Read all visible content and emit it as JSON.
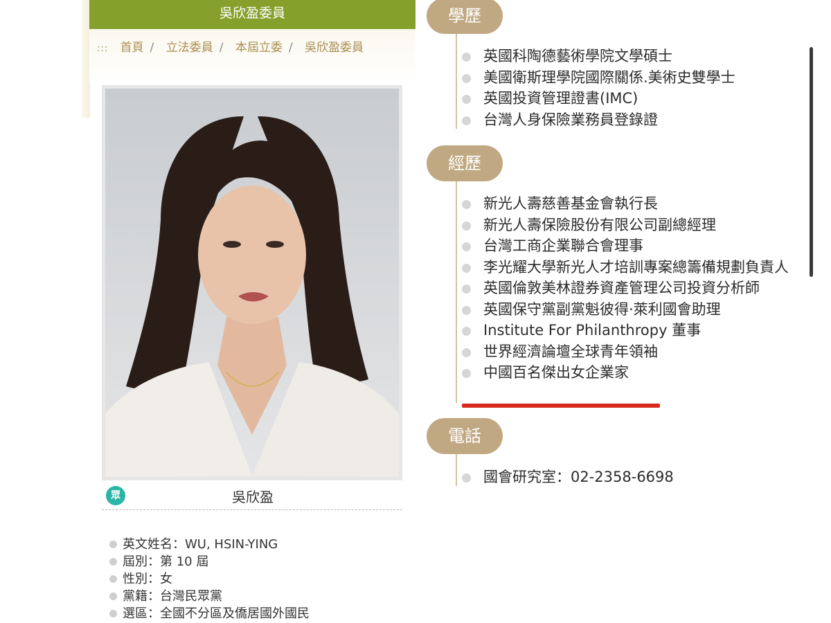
{
  "header": {
    "title": "吳欣盈委員"
  },
  "breadcrumb": {
    "prefix": ":::",
    "items": [
      "首頁",
      "立法委員",
      "本屆立委",
      "吳欣盈委員"
    ]
  },
  "profile": {
    "party_icon_label": "眾",
    "name": "吳欣盈",
    "info": [
      "英文姓名：WU, HSIN-YING",
      "屆別：第 10 屆",
      "性別：女",
      "黨籍：台灣民眾黨",
      "選區：全國不分區及僑居國外國民"
    ]
  },
  "sections": {
    "education": {
      "label": "學歷",
      "items": [
        "英國科陶德藝術學院文學碩士",
        "美國衛斯理學院國際關係.美術史雙學士",
        "英國投資管理證書(IMC)",
        "台灣人身保險業務員登錄證"
      ]
    },
    "experience": {
      "label": "經歷",
      "items": [
        "新光人壽慈善基金會執行長",
        "新光人壽保險股份有限公司副總經理",
        "台灣工商企業聯合會理事",
        "李光耀大學新光人才培訓專案總籌備規劃負責人",
        "英國倫敦美林證券資產管理公司投資分析師",
        "英國保守黨副黨魁彼得·萊利國會助理",
        "Institute For Philanthropy 董事",
        "世界經濟論壇全球青年領袖",
        "中國百名傑出女企業家"
      ]
    },
    "phone": {
      "label": "電話",
      "items": [
        "國會研究室：02-2358-6698"
      ]
    }
  },
  "colors": {
    "title_bar": "#86a02c",
    "section_tag": "#c0a882",
    "breadcrumb_text": "#a98d4f",
    "highlight_underline": "#d62b1c",
    "party_badge": "#2bb5a8"
  }
}
